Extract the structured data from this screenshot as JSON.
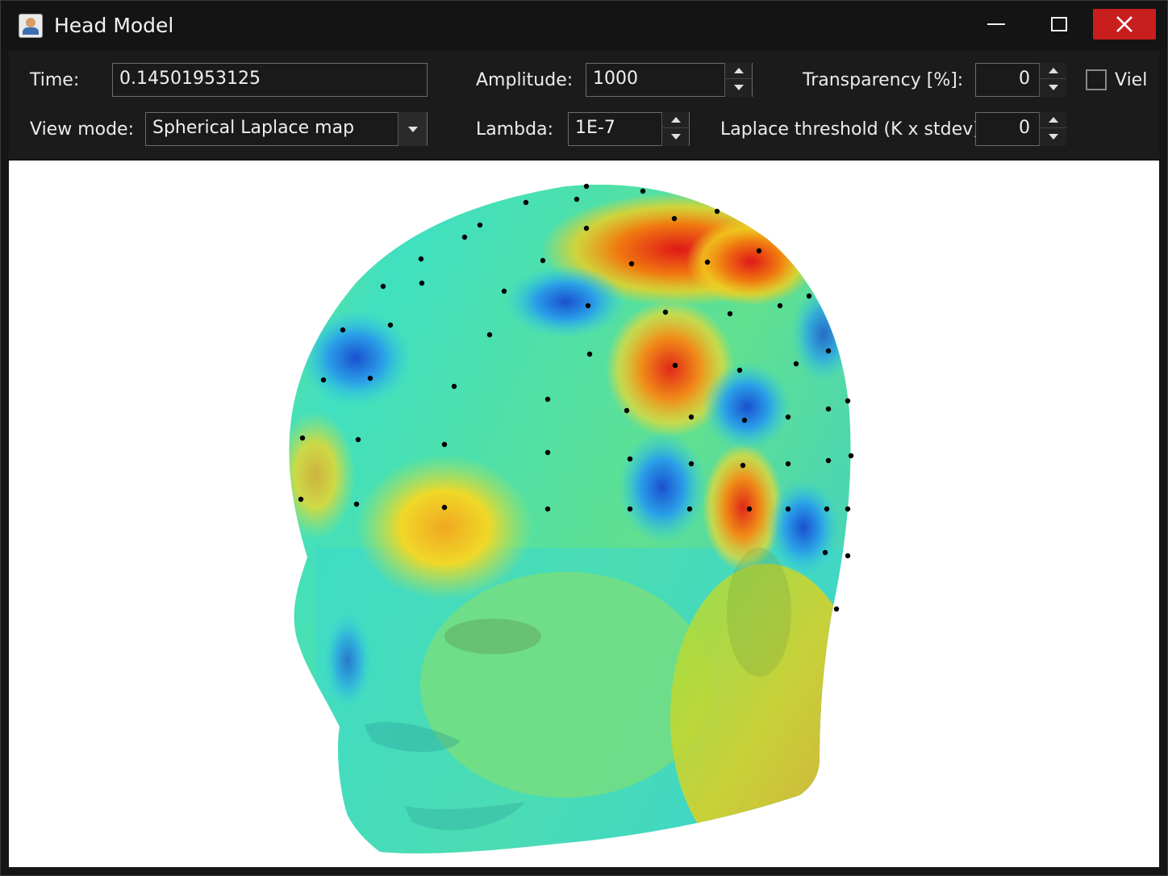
{
  "window": {
    "title": "Head Model",
    "icons": {
      "app": "app-icon",
      "minimize": "minimize-icon",
      "maximize": "maximize-icon",
      "close": "close-icon"
    }
  },
  "controls": {
    "time": {
      "label": "Time:",
      "value": "0.14501953125"
    },
    "amplitude": {
      "label": "Amplitude:",
      "value": "1000"
    },
    "transparency": {
      "label": "Transparency [%]:",
      "value": "0"
    },
    "view_checkbox": {
      "label": "Viel",
      "checked": false
    },
    "view_mode": {
      "label": "View mode:",
      "value": "Spherical Laplace map"
    },
    "lambda": {
      "label": "Lambda:",
      "value": "1E-7"
    },
    "laplace_threshold": {
      "label": "Laplace threshold (K x stdev):",
      "value": "0"
    }
  },
  "viewport": {
    "content": "3D head model with spherical Laplace colormap and electrode markers",
    "colors": {
      "background": "#ffffff",
      "low": "#1e64d8",
      "mid": "#3ad6c8",
      "neutral": "#8ee04a",
      "high_mid": "#f0d020",
      "high": "#e02818"
    }
  },
  "colors": {
    "window_bg": "#151515",
    "close_button": "#c81e1e"
  }
}
